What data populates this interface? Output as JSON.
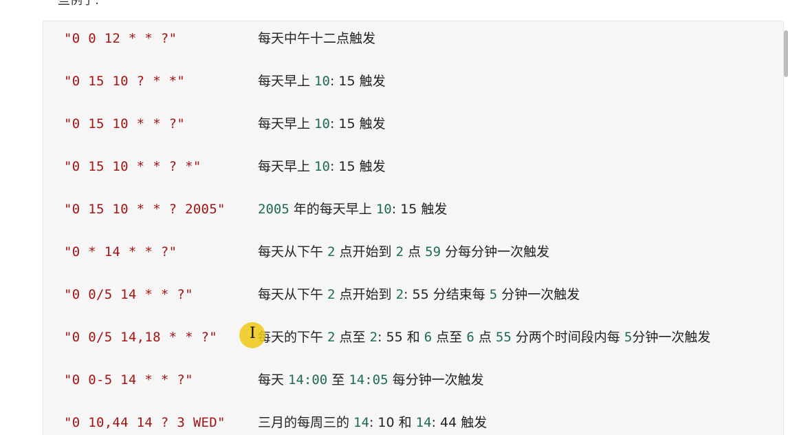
{
  "top_fragment": "些例子:",
  "rows": [
    {
      "expr": "\"0 0 12 * * ?\"",
      "parts": [
        {
          "t": "每天中午十二点触发",
          "n": false
        }
      ]
    },
    {
      "expr": "\"0 15 10 ? * *\"",
      "parts": [
        {
          "t": "每天早上 ",
          "n": false
        },
        {
          "t": "10",
          "n": true
        },
        {
          "t": ": ",
          "n": false
        },
        {
          "t": "15",
          "n": false
        },
        {
          "t": " 触发",
          "n": false
        }
      ]
    },
    {
      "expr": "\"0 15 10 * * ?\"",
      "parts": [
        {
          "t": "每天早上 ",
          "n": false
        },
        {
          "t": "10",
          "n": true
        },
        {
          "t": ": ",
          "n": false
        },
        {
          "t": "15",
          "n": false
        },
        {
          "t": " 触发",
          "n": false
        }
      ]
    },
    {
      "expr": "\"0 15 10 * * ? *\"",
      "parts": [
        {
          "t": "每天早上 ",
          "n": false
        },
        {
          "t": "10",
          "n": true
        },
        {
          "t": ": ",
          "n": false
        },
        {
          "t": "15",
          "n": false
        },
        {
          "t": " 触发",
          "n": false
        }
      ]
    },
    {
      "expr": "\"0 15 10 * * ? 2005\"",
      "parts": [
        {
          "t": "2005",
          "n": true
        },
        {
          "t": " 年的每天早上 ",
          "n": false
        },
        {
          "t": "10",
          "n": true
        },
        {
          "t": ": ",
          "n": false
        },
        {
          "t": "15",
          "n": false
        },
        {
          "t": " 触发",
          "n": false
        }
      ]
    },
    {
      "expr": "\"0 * 14 * * ?\"",
      "parts": [
        {
          "t": "每天从下午 ",
          "n": false
        },
        {
          "t": "2",
          "n": true
        },
        {
          "t": " 点开始到 ",
          "n": false
        },
        {
          "t": "2",
          "n": true
        },
        {
          "t": " 点 ",
          "n": false
        },
        {
          "t": "59",
          "n": true
        },
        {
          "t": " 分每分钟一次触发",
          "n": false
        }
      ]
    },
    {
      "expr": "\"0 0/5 14 * * ?\"",
      "parts": [
        {
          "t": "每天从下午 ",
          "n": false
        },
        {
          "t": "2",
          "n": true
        },
        {
          "t": " 点开始到 ",
          "n": false
        },
        {
          "t": "2",
          "n": true
        },
        {
          "t": ": ",
          "n": false
        },
        {
          "t": "55",
          "n": false
        },
        {
          "t": " 分结束每 ",
          "n": false
        },
        {
          "t": "5",
          "n": true
        },
        {
          "t": " 分钟一次触发",
          "n": false
        }
      ]
    },
    {
      "expr": "\"0 0/5 14,18 * * ?\"",
      "parts": [
        {
          "t": "每天的下午 ",
          "n": false
        },
        {
          "t": "2",
          "n": true
        },
        {
          "t": " 点至 ",
          "n": false
        },
        {
          "t": "2",
          "n": true
        },
        {
          "t": ": ",
          "n": false
        },
        {
          "t": "55",
          "n": false
        },
        {
          "t": " 和 ",
          "n": false
        },
        {
          "t": "6",
          "n": true
        },
        {
          "t": " 点至 ",
          "n": false
        },
        {
          "t": "6",
          "n": true
        },
        {
          "t": " 点 ",
          "n": false
        },
        {
          "t": "55",
          "n": true
        },
        {
          "t": " 分两个时间段内每 ",
          "n": false
        },
        {
          "t": "5",
          "n": true
        },
        {
          "t": "分钟一次触发",
          "n": false
        }
      ]
    },
    {
      "expr": "\"0 0-5 14 * * ?\"",
      "parts": [
        {
          "t": "每天 ",
          "n": false
        },
        {
          "t": "14:00",
          "n": true
        },
        {
          "t": " 至 ",
          "n": false
        },
        {
          "t": "14:05",
          "n": true
        },
        {
          "t": " 每分钟一次触发",
          "n": false
        }
      ]
    },
    {
      "expr": "\"0 10,44 14 ? 3 WED\"",
      "parts": [
        {
          "t": "三月的每周三的 ",
          "n": false
        },
        {
          "t": "14",
          "n": true
        },
        {
          "t": ": ",
          "n": false
        },
        {
          "t": "10",
          "n": false
        },
        {
          "t": " 和 ",
          "n": false
        },
        {
          "t": "14",
          "n": true
        },
        {
          "t": ": ",
          "n": false
        },
        {
          "t": "44",
          "n": false
        },
        {
          "t": " 触发",
          "n": false
        }
      ]
    }
  ],
  "cursor_glyph": "I"
}
